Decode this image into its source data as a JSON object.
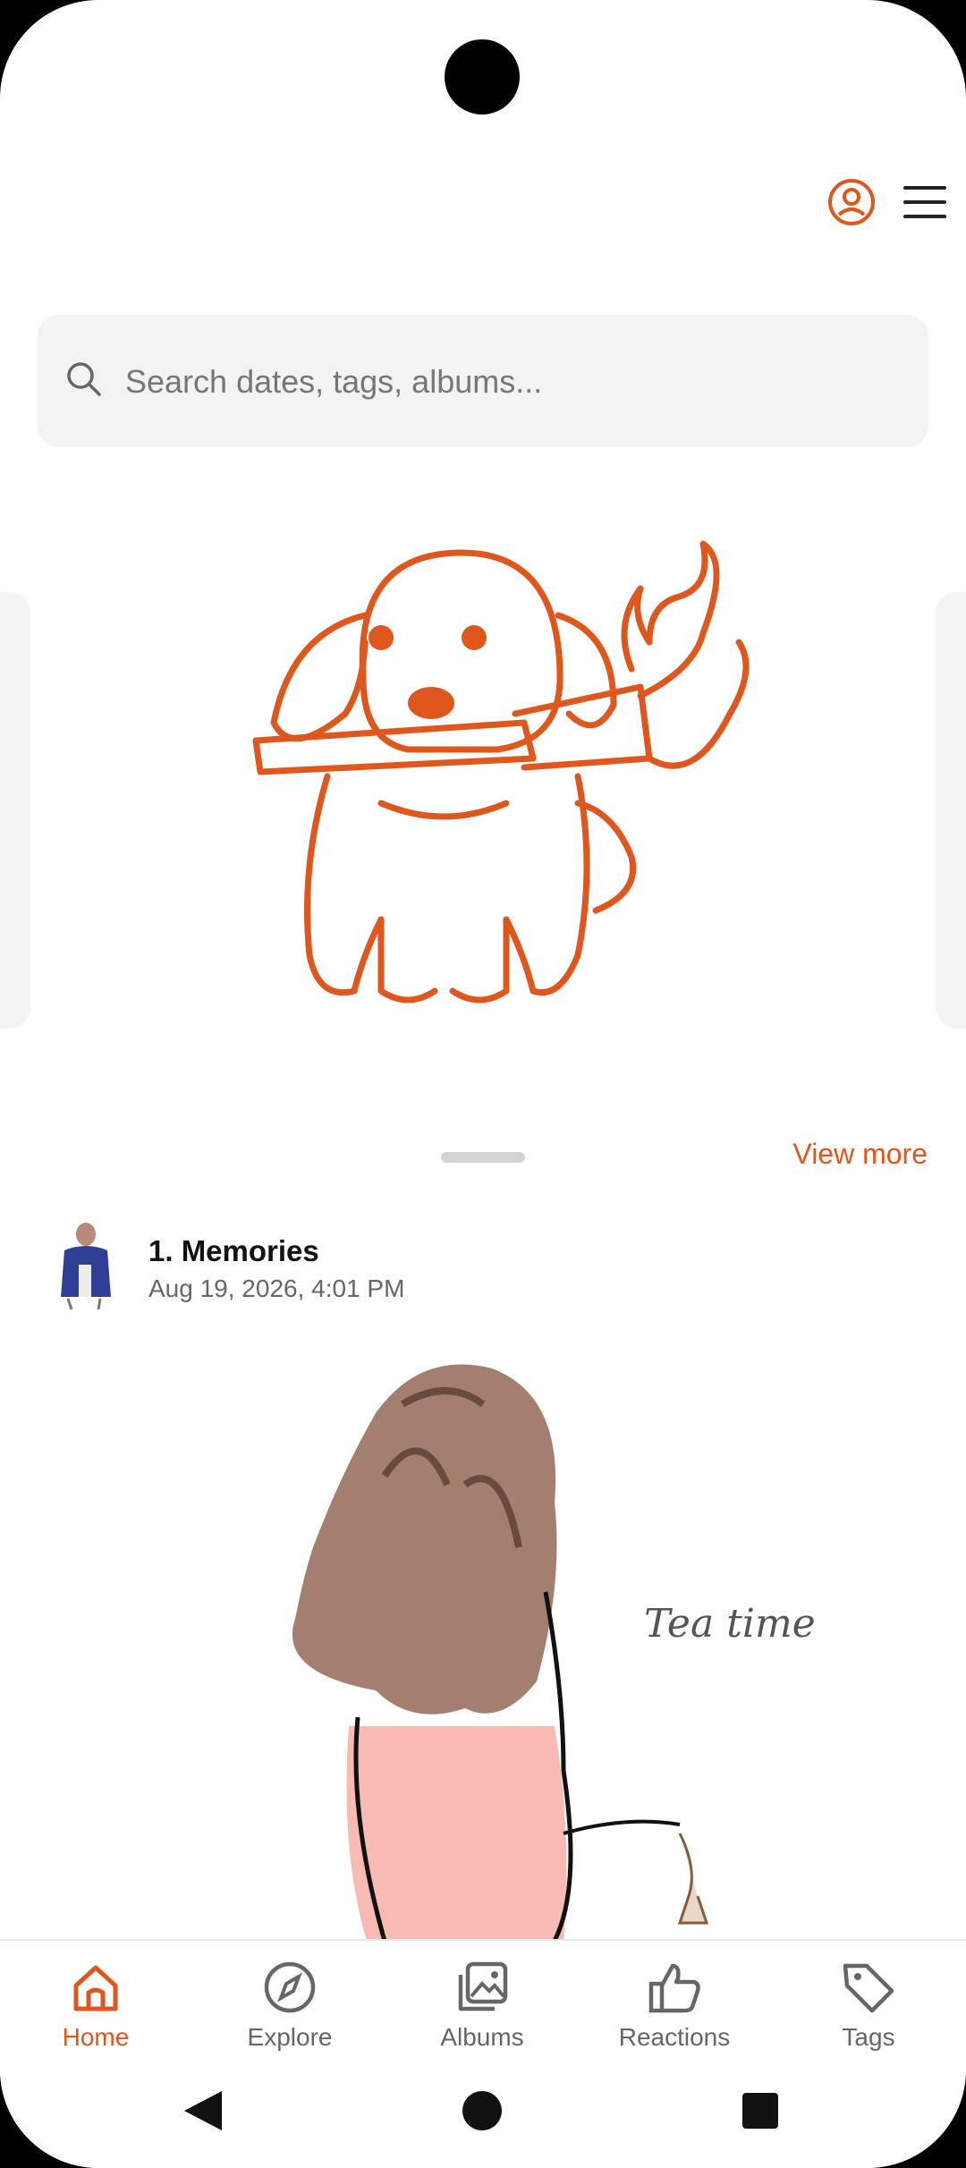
{
  "colors": {
    "accent": "#e0571d",
    "text_muted": "#666666"
  },
  "header": {
    "profile_icon": "user-circle-icon",
    "menu_icon": "hamburger-menu-icon"
  },
  "search": {
    "placeholder": "Search dates, tags, albums..."
  },
  "featured": {
    "image": "dog-holding-torch-illustration"
  },
  "feed": {
    "view_more": "View more",
    "posts": [
      {
        "title": "1. Memories",
        "date": "Aug 19, 2026, 4:01 PM",
        "image_caption": "Tea time"
      }
    ]
  },
  "nav": {
    "items": [
      {
        "label": "Home",
        "icon": "home-icon",
        "active": true
      },
      {
        "label": "Explore",
        "icon": "compass-icon",
        "active": false
      },
      {
        "label": "Albums",
        "icon": "albums-icon",
        "active": false
      },
      {
        "label": "Reactions",
        "icon": "thumbs-up-icon",
        "active": false
      },
      {
        "label": "Tags",
        "icon": "tag-icon",
        "active": false
      }
    ]
  }
}
